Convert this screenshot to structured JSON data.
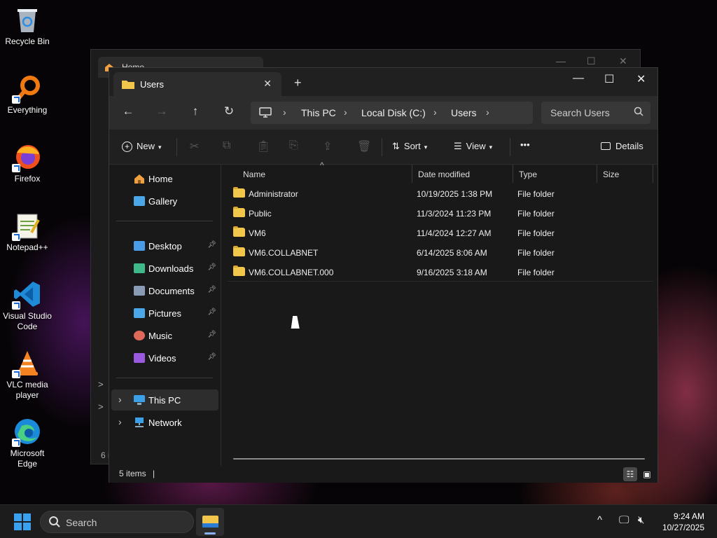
{
  "desktop": {
    "icons": [
      {
        "label": "Recycle Bin",
        "icon": "recycle-bin-icon"
      },
      {
        "label": "Everything",
        "icon": "everything-search-icon"
      },
      {
        "label": "Firefox",
        "icon": "firefox-icon"
      },
      {
        "label": "Notepad++",
        "icon": "notepad-plus-plus-icon"
      },
      {
        "label": "Visual Studio Code",
        "icon": "vscode-icon"
      },
      {
        "label": "VLC media player",
        "icon": "vlc-icon"
      },
      {
        "label": "Microsoft Edge",
        "icon": "edge-icon"
      }
    ]
  },
  "background_window": {
    "tab_title": "Home",
    "side_chevron": ">",
    "status_fragment": "6 i"
  },
  "window": {
    "tab_title": "Users",
    "tab_close": "✕",
    "new_tab": "+",
    "controls": {
      "minimize": "—",
      "maximize": "☐",
      "close": "✕"
    }
  },
  "navigation": {
    "back": "←",
    "forward": "→",
    "up": "↑",
    "refresh": "↻",
    "breadcrumb": [
      "This PC",
      "Local Disk (C:)",
      "Users"
    ],
    "search_placeholder": "Search Users"
  },
  "toolbar": {
    "new_label": "New",
    "sort_label": "Sort",
    "view_label": "View",
    "more_label": "•••",
    "details_label": "Details"
  },
  "sidebar": {
    "top": [
      {
        "label": "Home",
        "icon": "home-icon",
        "color": "#f0a040"
      },
      {
        "label": "Gallery",
        "icon": "gallery-icon",
        "color": "#4aa8e8"
      }
    ],
    "pinned": [
      {
        "label": "Desktop",
        "icon": "desktop-folder-icon",
        "color": "#4a9be8"
      },
      {
        "label": "Downloads",
        "icon": "downloads-folder-icon",
        "color": "#3fb98a"
      },
      {
        "label": "Documents",
        "icon": "documents-folder-icon",
        "color": "#8a9bb5"
      },
      {
        "label": "Pictures",
        "icon": "pictures-folder-icon",
        "color": "#4aa8e8"
      },
      {
        "label": "Music",
        "icon": "music-folder-icon",
        "color": "#e06a5a"
      },
      {
        "label": "Videos",
        "icon": "videos-folder-icon",
        "color": "#9a5ae0"
      }
    ],
    "drives": [
      {
        "label": "This PC",
        "icon": "this-pc-icon",
        "color": "#3aa0e8",
        "selected": true
      },
      {
        "label": "Network",
        "icon": "network-icon",
        "color": "#3aa0e8",
        "selected": false
      }
    ]
  },
  "columns": [
    "Name",
    "Date modified",
    "Type",
    "Size"
  ],
  "files": [
    {
      "name": "Administrator",
      "date": "10/19/2025 1:38 PM",
      "type": "File folder",
      "size": ""
    },
    {
      "name": "Public",
      "date": "11/3/2024 11:23 PM",
      "type": "File folder",
      "size": ""
    },
    {
      "name": "VM6",
      "date": "11/4/2024 12:27 AM",
      "type": "File folder",
      "size": ""
    },
    {
      "name": "VM6.COLLABNET",
      "date": "6/14/2025 8:06 AM",
      "type": "File folder",
      "size": ""
    },
    {
      "name": "VM6.COLLABNET.000",
      "date": "9/16/2025 3:18 AM",
      "type": "File folder",
      "size": ""
    }
  ],
  "status": {
    "item_count": "5 items"
  },
  "taskbar": {
    "search_placeholder": "Search",
    "time": "9:24 AM",
    "date": "10/27/2025"
  },
  "colors": {
    "folder": "#f2c54b",
    "accent": "#3aa0f0"
  }
}
